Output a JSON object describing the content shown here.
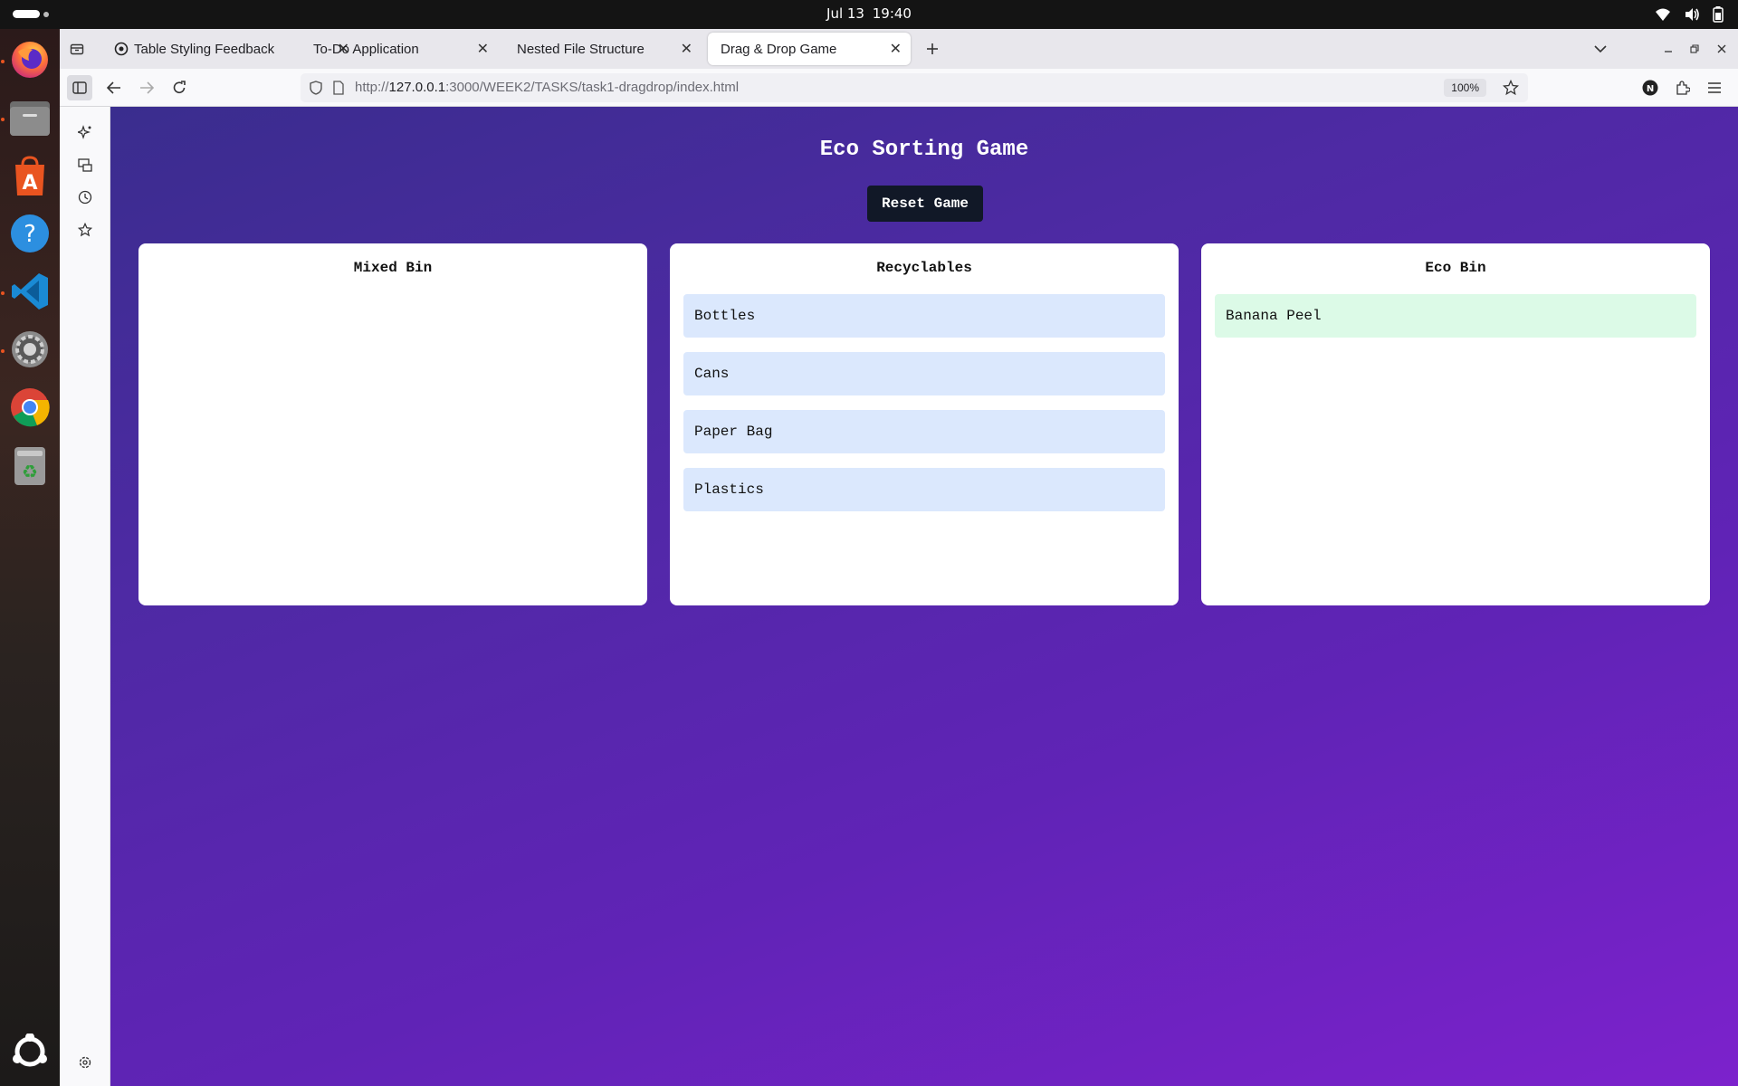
{
  "system": {
    "date": "Jul 13",
    "time": "19:40"
  },
  "dock": {
    "apps": [
      "firefox-icon",
      "files-icon",
      "app-center-icon",
      "help-icon",
      "vscode-icon",
      "settings-icon",
      "chrome-icon",
      "trash-icon",
      "ubuntu-apps-icon"
    ]
  },
  "browser": {
    "tabs": [
      {
        "label": "Table Styling Feedback",
        "active": false
      },
      {
        "label": "To-Do Application",
        "active": false
      },
      {
        "label": "Nested File Structure",
        "active": false
      },
      {
        "label": "Drag & Drop Game",
        "active": true
      }
    ],
    "url": {
      "scheme": "http://",
      "host": "127.0.0.1",
      "rest": ":3000/WEEK2/TASKS/task1-dragdrop/index.html"
    },
    "zoom": "100%",
    "profile_initial": "N"
  },
  "game": {
    "title": "Eco Sorting Game",
    "reset_label": "Reset Game",
    "bins": [
      {
        "title": "Mixed Bin",
        "kind": "mixed",
        "items": []
      },
      {
        "title": "Recyclables",
        "kind": "recycle",
        "items": [
          "Bottles",
          "Cans",
          "Paper Bag",
          "Plastics"
        ]
      },
      {
        "title": "Eco Bin",
        "kind": "eco",
        "items": [
          "Banana Peel"
        ]
      }
    ]
  },
  "colors": {
    "page_gradient_start": "#3a2d8e",
    "page_gradient_end": "#7c22cc",
    "reset_button": "#111827",
    "recycle_item": "#dbe8fd",
    "eco_item": "#dcfae7",
    "ubuntu_accent": "#e95420"
  }
}
